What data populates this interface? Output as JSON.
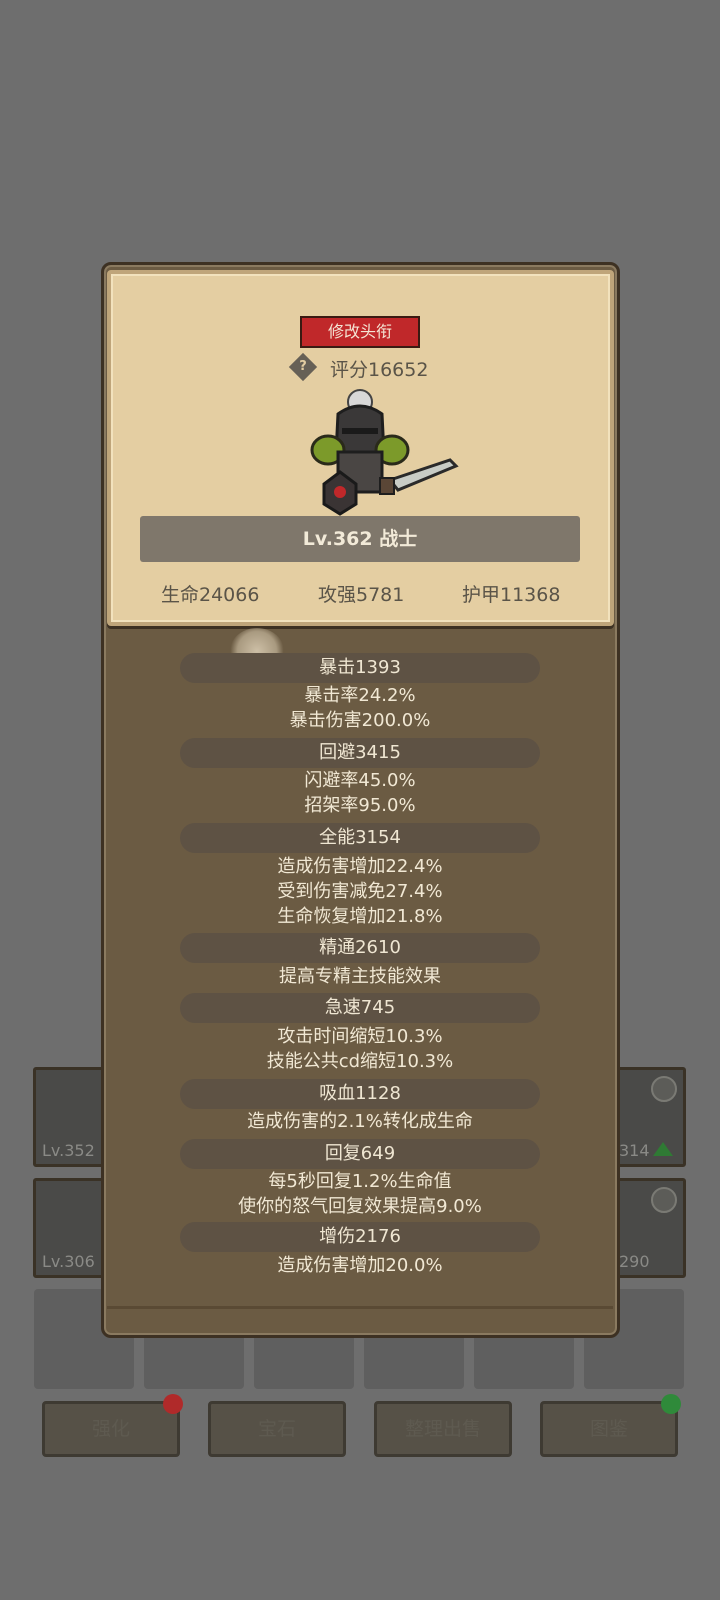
{
  "background": {
    "left_slots": [
      {
        "level": "Lv.352"
      },
      {
        "level": "Lv.306"
      }
    ],
    "right_slots": [
      {
        "level": "314"
      },
      {
        "level": "290"
      }
    ],
    "bottom_buttons": [
      "强化",
      "宝石",
      "整理出售",
      "图鉴"
    ]
  },
  "profile": {
    "rename_button": "修改头衔",
    "help_icon": "?",
    "score": "评分16652",
    "level_class": "Lv.362 战士",
    "hp": "生命24066",
    "attack": "攻强5781",
    "armor": "护甲11368"
  },
  "sections": [
    {
      "header": "暴击1393",
      "lines": [
        "暴击率24.2%",
        "暴击伤害200.0%"
      ]
    },
    {
      "header": "回避3415",
      "lines": [
        "闪避率45.0%",
        "招架率95.0%"
      ]
    },
    {
      "header": "全能3154",
      "lines": [
        "造成伤害增加22.4%",
        "受到伤害减免27.4%",
        "生命恢复增加21.8%"
      ]
    },
    {
      "header": "精通2610",
      "lines": [
        "提高专精主技能效果"
      ]
    },
    {
      "header": "急速745",
      "lines": [
        "攻击时间缩短10.3%",
        "技能公共cd缩短10.3%"
      ]
    },
    {
      "header": "吸血1128",
      "lines": [
        "造成伤害的2.1%转化成生命"
      ]
    },
    {
      "header": "回复649",
      "lines": [
        "每5秒回复1.2%生命值",
        "使你的怒气回复效果提高9.0%"
      ]
    },
    {
      "header": "增伤2176",
      "lines": [
        "造成伤害增加20.0%"
      ]
    }
  ],
  "colors": {
    "overlay": "#6e6e6e",
    "parchment": "#e4cea2",
    "panel": "#6b5b43",
    "rename_red": "#c0282a",
    "badge_red": "#b02a2a",
    "badge_green": "#2f8a3a"
  }
}
